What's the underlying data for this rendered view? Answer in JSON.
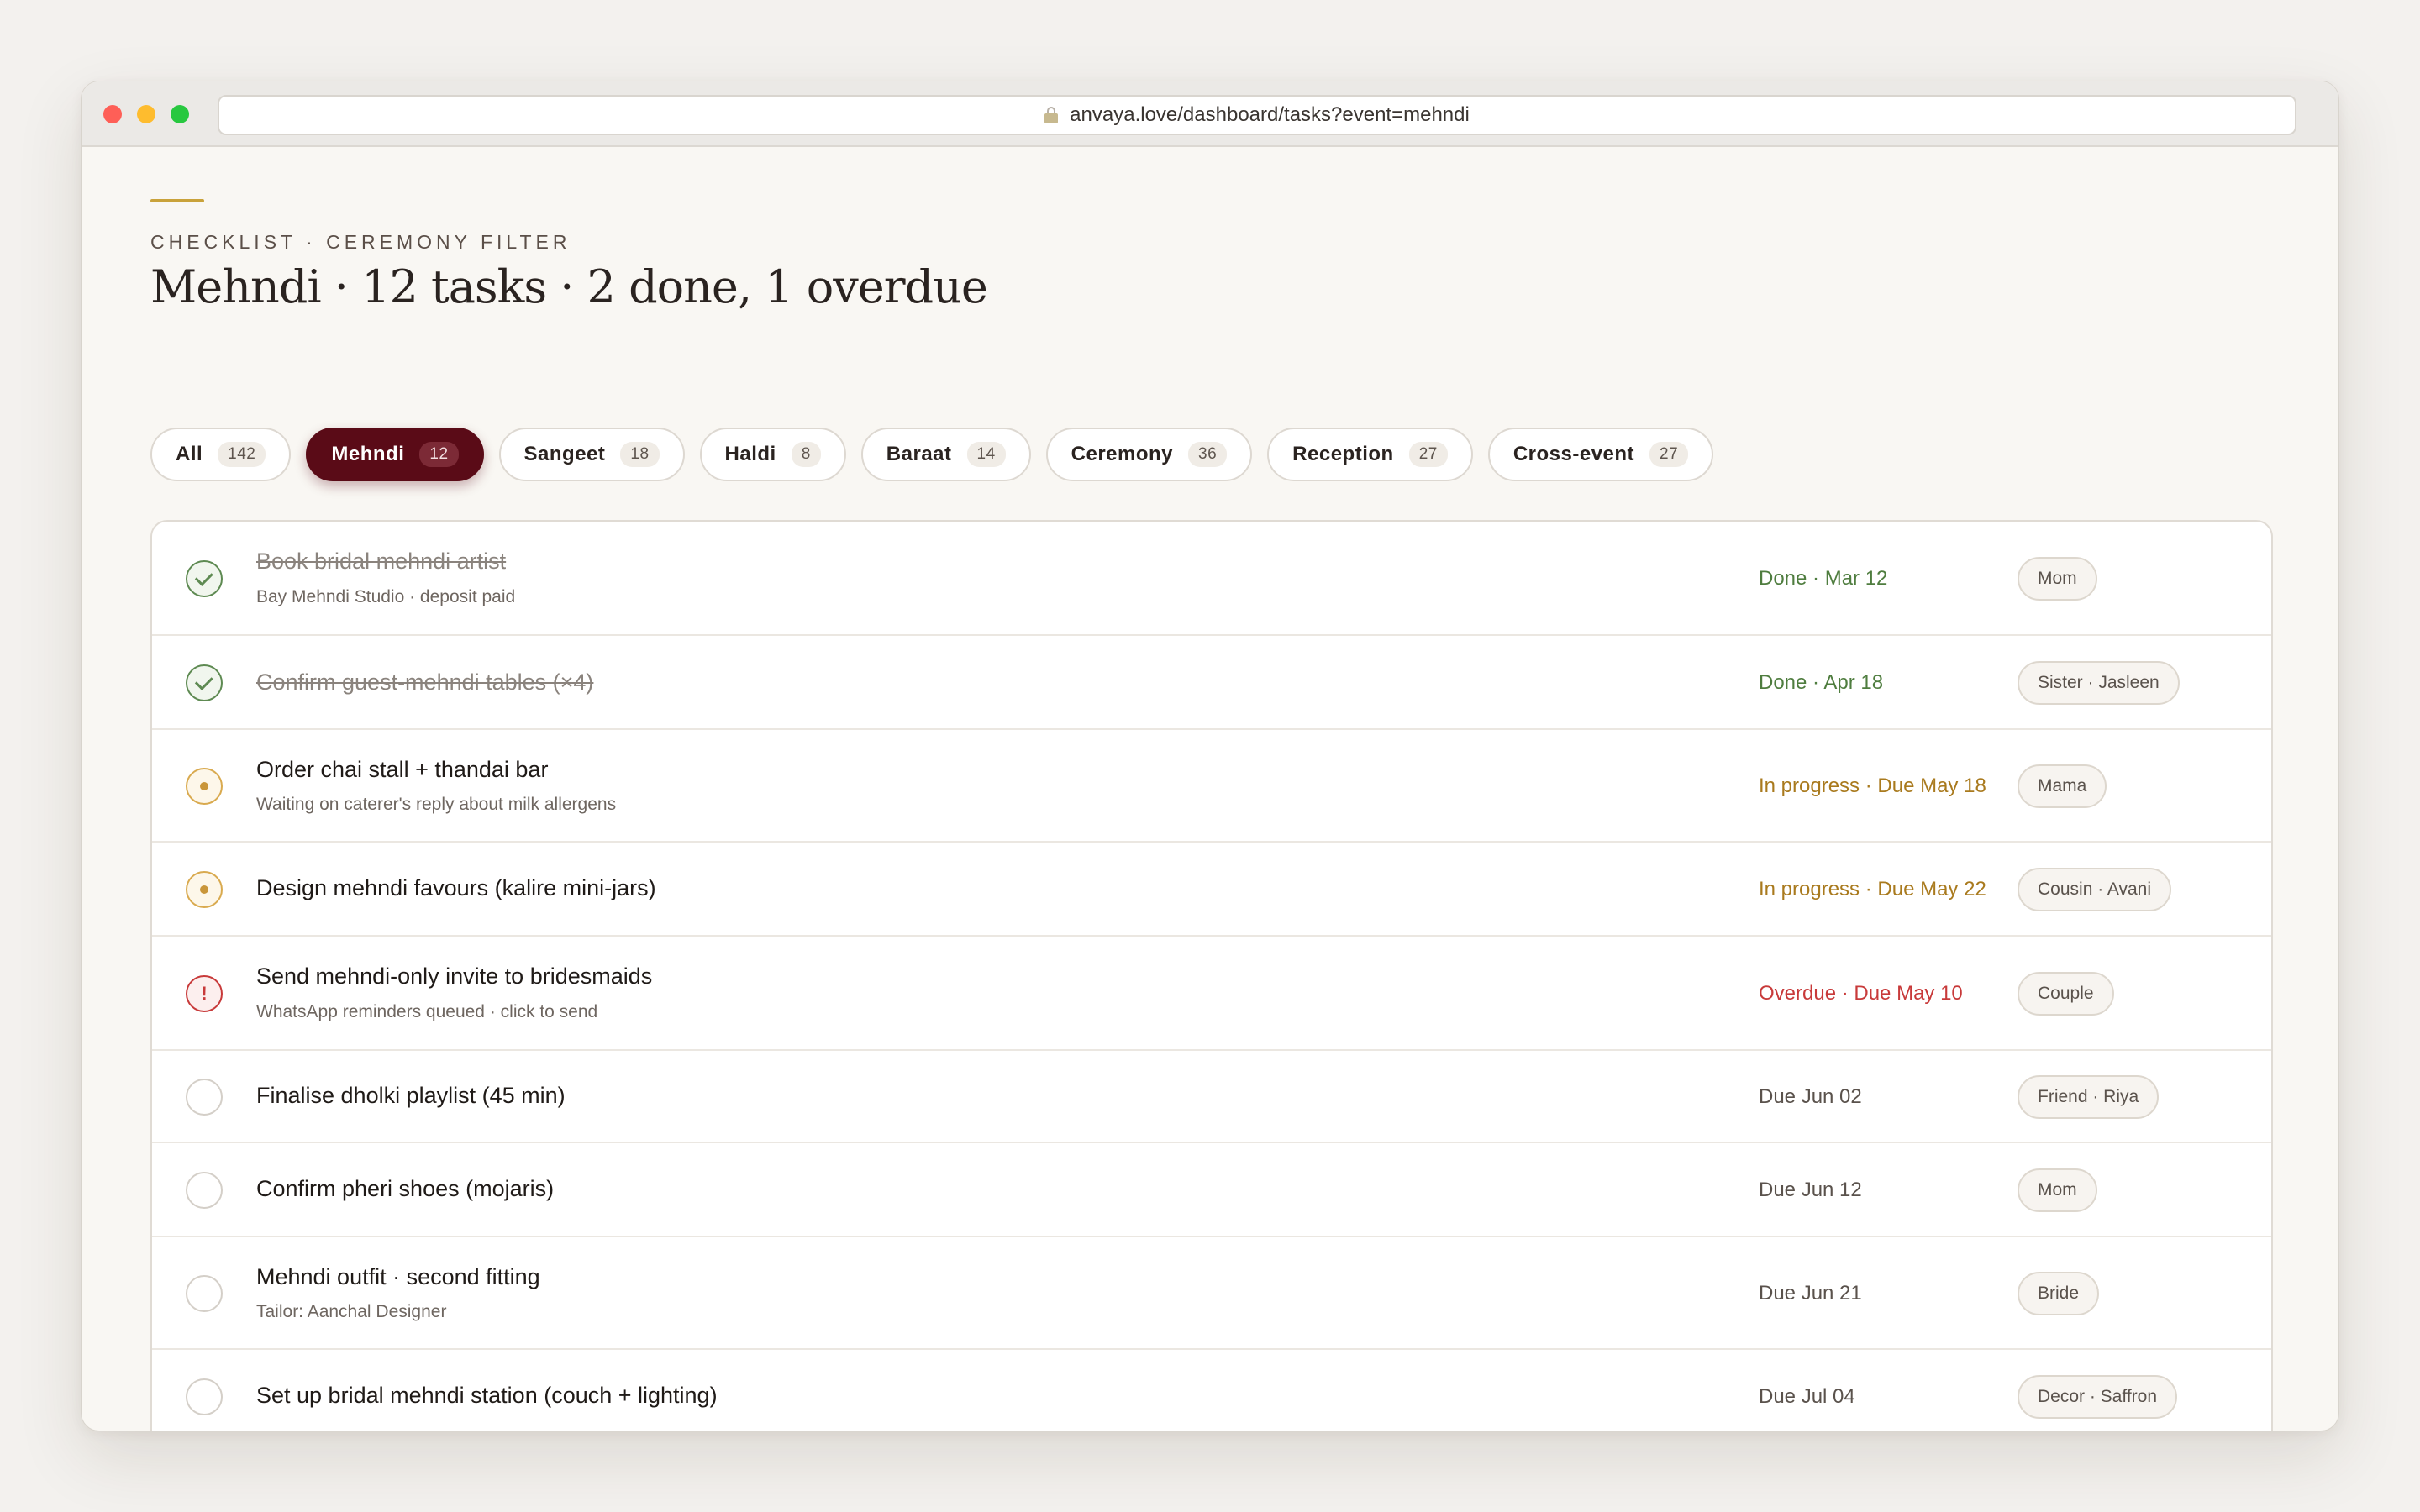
{
  "browser": {
    "url": "anvaya.love/dashboard/tasks?event=mehndi"
  },
  "header": {
    "eyebrow": "CHECKLIST · CEREMONY FILTER",
    "title": "Mehndi · 12 tasks · 2 done, 1 overdue"
  },
  "filters": [
    {
      "label": "All",
      "count": "142"
    },
    {
      "label": "Mehndi",
      "count": "12",
      "active": true
    },
    {
      "label": "Sangeet",
      "count": "18"
    },
    {
      "label": "Haldi",
      "count": "8"
    },
    {
      "label": "Baraat",
      "count": "14"
    },
    {
      "label": "Ceremony",
      "count": "36"
    },
    {
      "label": "Reception",
      "count": "27"
    },
    {
      "label": "Cross-event",
      "count": "27"
    }
  ],
  "tasks": [
    {
      "title": "Book bridal mehndi artist",
      "subtitle": "Bay Mehndi Studio · deposit paid",
      "state": "done",
      "status": "Done · Mar 12",
      "assignee": "Mom"
    },
    {
      "title": "Confirm guest-mehndi tables (×4)",
      "subtitle": "",
      "state": "done",
      "status": "Done · Apr 18",
      "assignee": "Sister · Jasleen"
    },
    {
      "title": "Order chai stall + thandai bar",
      "subtitle": "Waiting on caterer's reply about milk allergens",
      "state": "progress",
      "status": "In progress · Due May 18",
      "assignee": "Mama"
    },
    {
      "title": "Design mehndi favours (kalire mini-jars)",
      "subtitle": "",
      "state": "progress",
      "status": "In progress · Due May 22",
      "assignee": "Cousin · Avani"
    },
    {
      "title": "Send mehndi-only invite to bridesmaids",
      "subtitle": "WhatsApp reminders queued · click to send",
      "state": "overdue",
      "status": "Overdue · Due May 10",
      "assignee": "Couple"
    },
    {
      "title": "Finalise dholki playlist (45 min)",
      "subtitle": "",
      "state": "todo",
      "status": "Due Jun 02",
      "assignee": "Friend · Riya"
    },
    {
      "title": "Confirm pheri shoes (mojaris)",
      "subtitle": "",
      "state": "todo",
      "status": "Due Jun 12",
      "assignee": "Mom"
    },
    {
      "title": "Mehndi outfit · second fitting",
      "subtitle": "Tailor: Aanchal Designer",
      "state": "todo",
      "status": "Due Jun 21",
      "assignee": "Bride"
    },
    {
      "title": "Set up bridal mehndi station (couch + lighting)",
      "subtitle": "",
      "state": "todo",
      "status": "Due Jul 04",
      "assignee": "Decor · Saffron"
    }
  ]
}
